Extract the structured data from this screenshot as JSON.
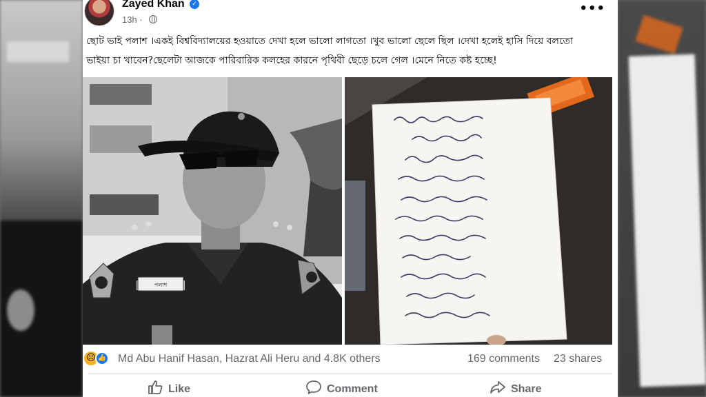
{
  "post": {
    "author": "Zayed Khan",
    "time": "13h ·",
    "more_label": "•••",
    "text_line1": "ছোট ভাই পলাশ ।একই বিশ্ববিদ্যালয়ের হওয়াতে দেখা হলে ভালো লাগতো ।খুব ভালো ছেলে ছিল ।দেখা হলেই হাসি দিয়ে  বলতো",
    "text_line2": "ভাইয়া চা খাবেন?ছেলেটা আজকে পারিবারিক কলহের কারনে পৃথিবী ছেড়ে চলে গেল ।মেনে নিতে কষ্ট হচ্ছে!",
    "name_badge": "পলাশ"
  },
  "engagement": {
    "reactions_text": "Md Abu Hanif Hasan, Hazrat Ali Heru and 4.8K others",
    "comments": "169 comments",
    "shares": "23 shares"
  },
  "actions": {
    "like": "Like",
    "comment": "Comment",
    "share": "Share"
  },
  "colors": {
    "accent": "#1877f2",
    "secondary_text": "#65676b",
    "reaction_sad": "#f7b125"
  }
}
